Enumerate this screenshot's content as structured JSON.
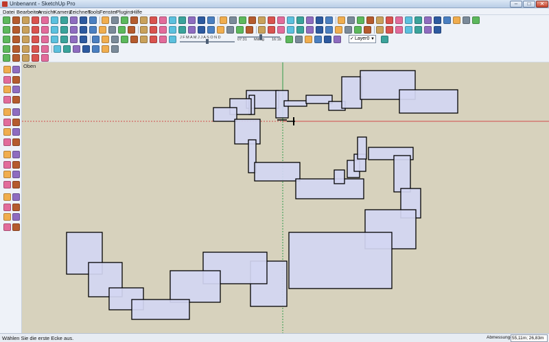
{
  "window": {
    "title": "Unbenannt - SketchUp Pro",
    "buttons": {
      "minimize": "–",
      "maximize": "□",
      "close": "✕"
    }
  },
  "menu": [
    "Datei",
    "Bearbeiten",
    "Ansicht",
    "Kamera",
    "Zeichnen",
    "Tools",
    "Fenster",
    "Plugins",
    "Hilfe"
  ],
  "shadows": {
    "months": "J F M A M J J A S O N D",
    "time_start": "07:31",
    "time_mid": "Mittag",
    "time_end": "16:18"
  },
  "layer": {
    "name": "Layer0",
    "check": "✓",
    "arrow": "▼"
  },
  "viewport": {
    "view_name": "Oben"
  },
  "status": {
    "hint": "Wählen Sie die erste Ecke aus.",
    "measure_label": "Abmessungen",
    "measure_value": "55,11m; 26,83m"
  },
  "colors": {
    "background": "#d7d2bd",
    "face_fill": "#d2d6f2",
    "edge": "#000000",
    "axis_red": "#d24a4a",
    "axis_green": "#2f9a4a"
  },
  "icons": {
    "toolbar": [
      "select-icon",
      "pencil-icon",
      "rectangle-icon",
      "circle-icon",
      "arc-icon",
      "polygon-icon",
      "freehand-icon",
      "eraser-icon",
      "paint-bucket-icon",
      "tape-measure-icon",
      "protractor-icon",
      "text-icon",
      "axes-icon",
      "dimension-icon",
      "section-plane-icon",
      "orbit-icon",
      "pan-icon",
      "zoom-icon",
      "zoom-window-icon",
      "zoom-extents-icon",
      "previous-view-icon",
      "next-view-icon",
      "position-camera-icon",
      "walk-icon",
      "look-around-icon",
      "push-pull-icon",
      "follow-me-icon",
      "offset-icon",
      "move-icon",
      "rotate-icon",
      "scale-icon"
    ],
    "left_tools": [
      "select-icon",
      "make-component-icon",
      "paint-bucket-icon",
      "eraser-icon",
      "rectangle-icon",
      "line-icon",
      "circle-icon",
      "arc-icon",
      "polygon-icon",
      "freehand-icon",
      "move-icon",
      "push-pull-icon",
      "rotate-icon",
      "follow-me-icon",
      "scale-icon",
      "offset-icon",
      "tape-measure-icon",
      "dimension-icon",
      "protractor-icon",
      "text-icon",
      "axes-icon",
      "3d-text-icon",
      "orbit-icon",
      "pan-icon",
      "zoom-icon",
      "zoom-window-icon",
      "zoom-extents-icon",
      "previous-icon",
      "position-camera-icon",
      "walk-icon",
      "look-around-icon",
      "section-plane-icon"
    ]
  }
}
